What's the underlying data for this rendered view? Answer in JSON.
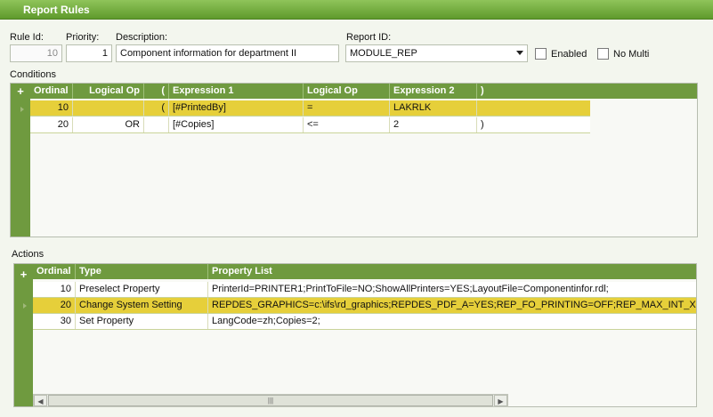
{
  "window": {
    "title": "Report Rules"
  },
  "form": {
    "rule_id_label": "Rule Id:",
    "rule_id": "10",
    "priority_label": "Priority:",
    "priority": "1",
    "description_label": "Description:",
    "description": "Component information for department II",
    "report_id_label": "Report ID:",
    "report_id": "MODULE_REP",
    "enabled_label": "Enabled",
    "no_multi_label": "No Multi"
  },
  "conditions": {
    "label": "Conditions",
    "add_symbol": "+",
    "headers": [
      "Ordinal",
      "Logical Op",
      "(",
      "Expression 1",
      "Logical Op",
      "Expression 2",
      ")"
    ],
    "rows": [
      {
        "ordinal": "10",
        "logical_op": "",
        "open": "(",
        "expr1": "[#PrintedBy]",
        "op": "=",
        "expr2": "LAKRLK",
        "close": ""
      },
      {
        "ordinal": "20",
        "logical_op": "OR",
        "open": "",
        "expr1": "[#Copies]",
        "op": "<=",
        "expr2": "2",
        "close": ")"
      }
    ]
  },
  "actions": {
    "label": "Actions",
    "add_symbol": "+",
    "headers": [
      "Ordinal",
      "Type",
      "Property List"
    ],
    "rows": [
      {
        "ordinal": "10",
        "type": "Preselect Property",
        "props": "PrinterId=PRINTER1;PrintToFile=NO;ShowAllPrinters=YES;LayoutFile=Componentinfor.rdl;"
      },
      {
        "ordinal": "20",
        "type": "Change System Setting",
        "props": "REPDES_GRAPHICS=c:\\ifs\\rd_graphics;REPDES_PDF_A=YES;REP_FO_PRINTING=OFF;REP_MAX_INT_XML_SIZE="
      },
      {
        "ordinal": "30",
        "type": "Set Property",
        "props": "LangCode=zh;Copies=2;"
      }
    ]
  }
}
